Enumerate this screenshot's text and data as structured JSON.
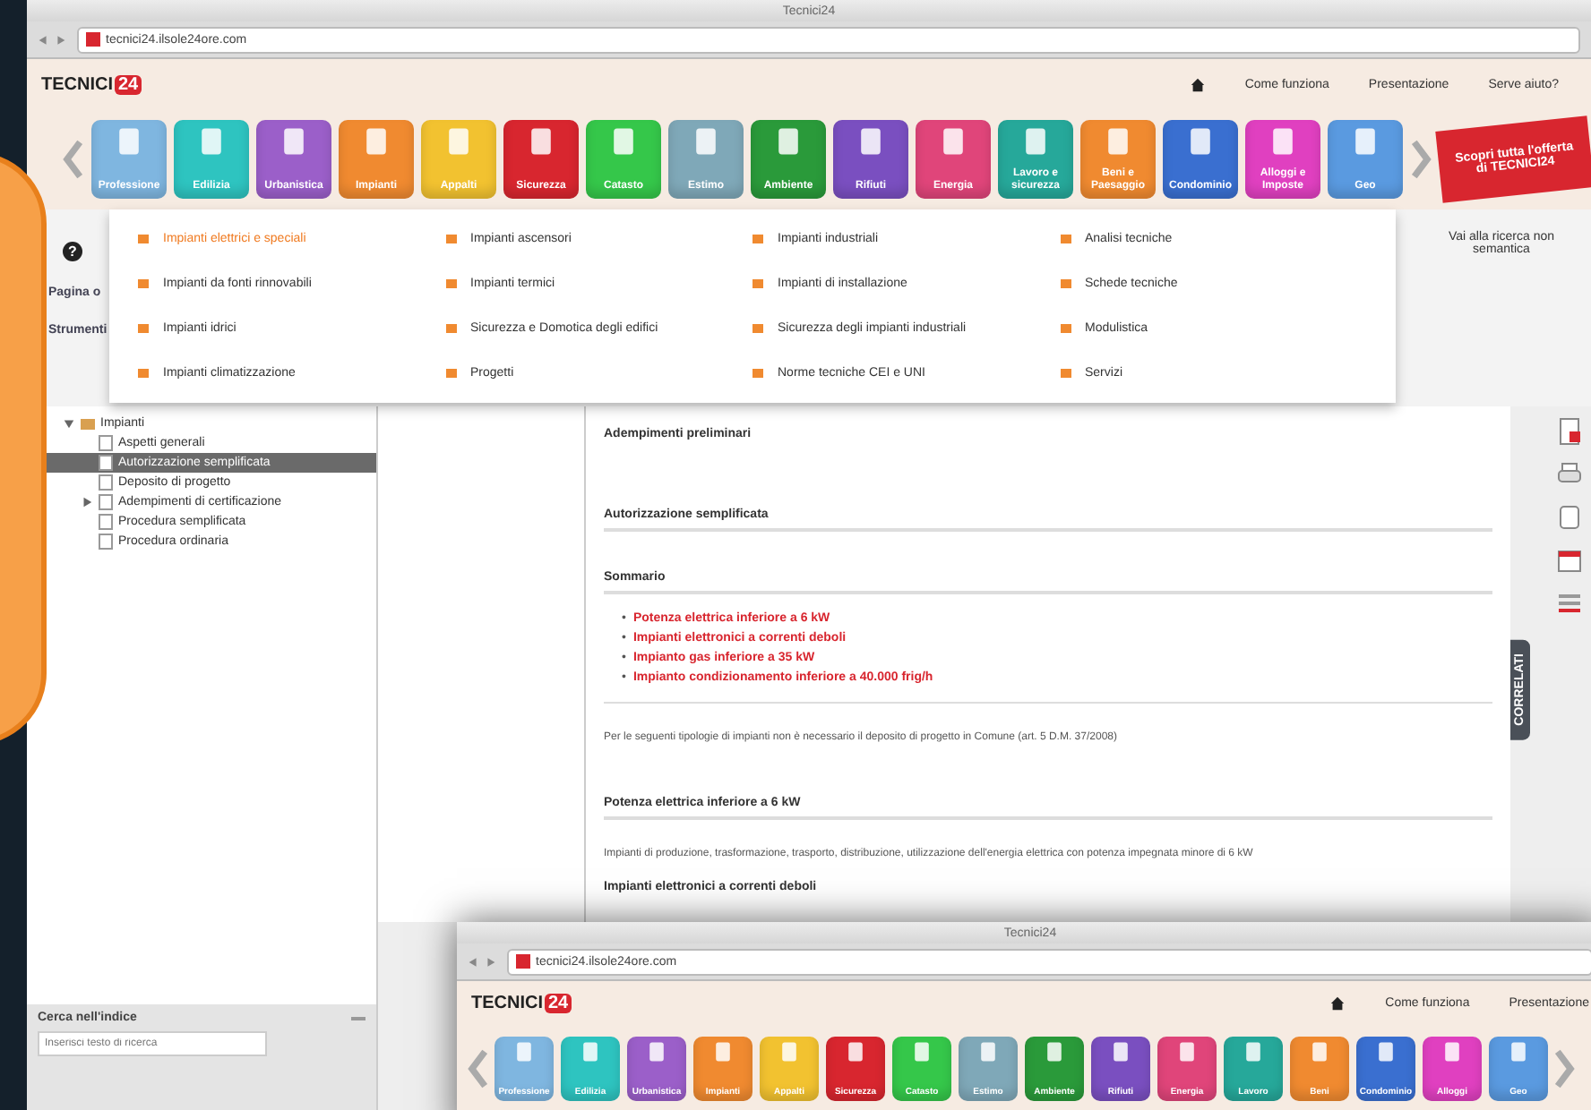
{
  "browser": {
    "title": "Tecnici24",
    "url": "tecnici24.ilsole24ore.com"
  },
  "header": {
    "logo_text": "TECNICI",
    "logo_badge": "24",
    "links": [
      "Come funziona",
      "Presentazione",
      "Serve aiuto?"
    ]
  },
  "categories": [
    {
      "label": "Professione",
      "color": "#7fb6e0"
    },
    {
      "label": "Edilizia",
      "color": "#2ec4c0"
    },
    {
      "label": "Urbanistica",
      "color": "#9b5fc9"
    },
    {
      "label": "Impianti",
      "color": "#f08a30"
    },
    {
      "label": "Appalti",
      "color": "#f2c230"
    },
    {
      "label": "Sicurezza",
      "color": "#d8262f"
    },
    {
      "label": "Catasto",
      "color": "#35c74a"
    },
    {
      "label": "Estimo",
      "color": "#7fa8b8"
    },
    {
      "label": "Ambiente",
      "color": "#2a9a3a"
    },
    {
      "label": "Rifiuti",
      "color": "#7a4fc0"
    },
    {
      "label": "Energia",
      "color": "#e0457a"
    },
    {
      "label": "Lavoro e sicurezza",
      "color": "#26a89a"
    },
    {
      "label": "Beni e Paesaggio",
      "color": "#f08a30"
    },
    {
      "label": "Condominio",
      "color": "#3a6fd0"
    },
    {
      "label": "Alloggi e Imposte",
      "color": "#e040c0"
    },
    {
      "label": "Geo",
      "color": "#5a9ae0"
    }
  ],
  "promo": "Scopri tutta l'offerta di TECNICI24",
  "menu": {
    "columns": [
      {
        "items": [
          {
            "label": "Impianti elettrici e speciali",
            "selected": true
          },
          {
            "label": "Impianti da fonti rinnovabili",
            "selected": false
          },
          {
            "label": "Impianti idrici",
            "selected": false
          },
          {
            "label": "Impianti climatizzazione",
            "selected": false
          }
        ]
      },
      {
        "items": [
          {
            "label": "Impianti ascensori",
            "selected": false
          },
          {
            "label": "Impianti termici",
            "selected": false
          },
          {
            "label": "Sicurezza e Domotica degli edifici",
            "selected": false
          },
          {
            "label": "Progetti",
            "selected": false
          }
        ]
      },
      {
        "items": [
          {
            "label": "Impianti industriali",
            "selected": false
          },
          {
            "label": "Impianti di installazione",
            "selected": false
          },
          {
            "label": "Sicurezza degli impianti industriali",
            "selected": false
          },
          {
            "label": "Norme tecniche CEI e UNI",
            "selected": false
          }
        ]
      },
      {
        "items": [
          {
            "label": "Analisi tecniche",
            "selected": false
          },
          {
            "label": "Schede tecniche",
            "selected": false
          },
          {
            "label": "Modulistica",
            "selected": false
          },
          {
            "label": "Servizi",
            "selected": false
          }
        ]
      }
    ]
  },
  "toolbar": {
    "help_icon": "?",
    "left_labels": [
      "Pagina o",
      "Strumenti"
    ],
    "semantic_link": "Vai alla ricerca non semantica"
  },
  "tree": [
    {
      "label": "Impianti",
      "expanded": true,
      "selected": false,
      "children": [
        {
          "label": "Aspetti generali",
          "selected": false
        },
        {
          "label": "Autorizzazione semplificata",
          "selected": true
        },
        {
          "label": "Deposito di progetto",
          "selected": false
        },
        {
          "label": "Adempimenti di certificazione",
          "selected": false,
          "expanded": false
        },
        {
          "label": "Procedura semplificata",
          "selected": false
        },
        {
          "label": "Procedura ordinaria",
          "selected": false
        }
      ]
    }
  ],
  "index_search": {
    "title": "Cerca nell'indice",
    "placeholder": "Inserisci testo di ricerca"
  },
  "document": [
    {
      "kind": "subheading",
      "text": "Adempimenti preliminari"
    },
    {
      "kind": "heading",
      "text": "Autorizzazione semplificata"
    },
    {
      "kind": "heading",
      "text": "Sommario"
    },
    {
      "kind": "list",
      "marker": "•",
      "items": [
        "Potenza elettrica inferiore a 6 kW",
        "Impianti elettronici a correnti deboli",
        "Impianto gas inferiore a 35 kW",
        "Impianto condizionamento inferiore a 40.000 frig/h"
      ]
    },
    {
      "kind": "paragraph",
      "text": "Per le seguenti tipologie di impianti non è necessario il deposito di progetto in Comune (art. 5 D.M. 37/2008)"
    },
    {
      "kind": "heading",
      "text": "Potenza elettrica inferiore a 6 kW"
    },
    {
      "kind": "paragraph",
      "text": "Impianti di produzione, trasformazione, trasporto, distribuzione, utilizzazione dell'energia elettrica con potenza impegnata minore di 6 kW"
    },
    {
      "kind": "subheading",
      "text": "Impianti elettronici a correnti deboli"
    }
  ],
  "side_tab": "CORRELATI",
  "second_window": {
    "title": "Tecnici24",
    "url": "tecnici24.ilsole24ore.com",
    "logo_text": "TECNICI",
    "logo_badge": "24",
    "links": [
      "Come funziona",
      "Presentazione"
    ],
    "categories": [
      {
        "label": "Professione",
        "color": "#7fb6e0"
      },
      {
        "label": "Edilizia",
        "color": "#2ec4c0"
      },
      {
        "label": "Urbanistica",
        "color": "#9b5fc9"
      },
      {
        "label": "Impianti",
        "color": "#f08a30"
      },
      {
        "label": "Appalti",
        "color": "#f2c230"
      },
      {
        "label": "Sicurezza",
        "color": "#d8262f"
      },
      {
        "label": "Catasto",
        "color": "#35c74a"
      },
      {
        "label": "Estimo",
        "color": "#7fa8b8"
      },
      {
        "label": "Ambiente",
        "color": "#2a9a3a"
      },
      {
        "label": "Rifiuti",
        "color": "#7a4fc0"
      },
      {
        "label": "Energia",
        "color": "#e0457a"
      },
      {
        "label": "Lavoro",
        "color": "#26a89a"
      },
      {
        "label": "Beni",
        "color": "#f08a30"
      },
      {
        "label": "Condominio",
        "color": "#3a6fd0"
      },
      {
        "label": "Alloggi",
        "color": "#e040c0"
      },
      {
        "label": "Geo",
        "color": "#5a9ae0"
      }
    ]
  }
}
